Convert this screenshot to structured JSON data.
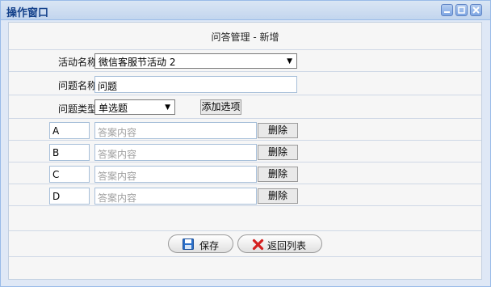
{
  "window": {
    "title": "操作窗口"
  },
  "form": {
    "title": "问答管理 - 新增",
    "activity_label": "活动名称",
    "activity_value": "微信客服节活动 2",
    "question_label": "问题名称",
    "question_value": "问题",
    "type_label": "问题类型",
    "type_value": "单选题",
    "add_option_label": "添加选项",
    "options": [
      {
        "letter": "A",
        "placeholder": "答案内容",
        "delete_label": "删除"
      },
      {
        "letter": "B",
        "placeholder": "答案内容",
        "delete_label": "删除"
      },
      {
        "letter": "C",
        "placeholder": "答案内容",
        "delete_label": "删除"
      },
      {
        "letter": "D",
        "placeholder": "答案内容",
        "delete_label": "删除"
      }
    ]
  },
  "actions": {
    "save_label": "保存",
    "back_label": "返回列表"
  },
  "icons": {
    "minimize": "minimize-icon",
    "maximize": "maximize-icon",
    "close": "close-icon",
    "save": "floppy-disk-icon",
    "back": "red-x-icon",
    "dropdown": "dropdown-arrow-icon"
  },
  "colors": {
    "title_text": "#15428b",
    "window_border": "#99bbe8",
    "back_icon": "#d42020",
    "save_icon": "#2a6fc9"
  }
}
